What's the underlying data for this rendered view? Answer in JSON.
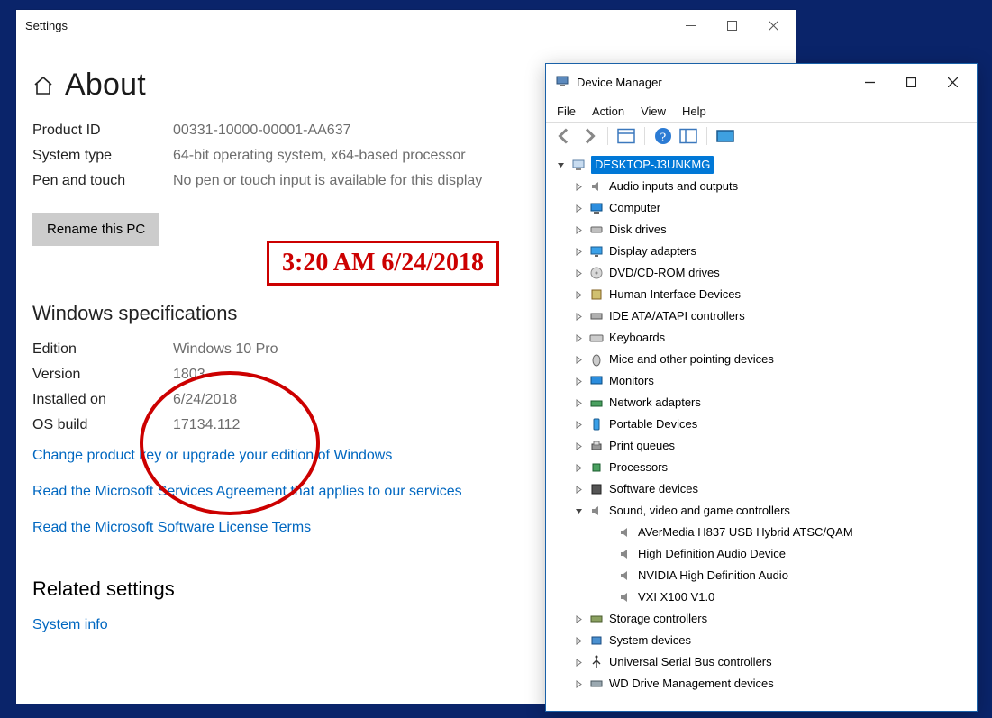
{
  "settings": {
    "window_title": "Settings",
    "page_title": "About",
    "device_specs": [
      {
        "label": "Product ID",
        "value": "00331-10000-00001-AA637"
      },
      {
        "label": "System type",
        "value": "64-bit operating system, x64-based processor"
      },
      {
        "label": "Pen and touch",
        "value": "No pen or touch input is available for this display"
      }
    ],
    "rename_button": "Rename this PC",
    "win_specs_heading": "Windows specifications",
    "win_specs": [
      {
        "label": "Edition",
        "value": "Windows 10 Pro"
      },
      {
        "label": "Version",
        "value": "1803"
      },
      {
        "label": "Installed on",
        "value": "6/24/2018"
      },
      {
        "label": "OS build",
        "value": "17134.112"
      }
    ],
    "links": [
      "Change product key or upgrade your edition of Windows",
      "Read the Microsoft Services Agreement that applies to our services",
      "Read the Microsoft Software License Terms"
    ],
    "related_heading": "Related settings",
    "related_link": "System info"
  },
  "annotation": {
    "timestamp": "3:20 AM 6/24/2018"
  },
  "device_manager": {
    "title": "Device Manager",
    "menus": [
      "File",
      "Action",
      "View",
      "Help"
    ],
    "root": "DESKTOP-J3UNKMG",
    "nodes": [
      {
        "label": "Audio inputs and outputs",
        "icon": "speaker-icon",
        "expanded": false
      },
      {
        "label": "Computer",
        "icon": "computer-icon",
        "expanded": false
      },
      {
        "label": "Disk drives",
        "icon": "disk-icon",
        "expanded": false
      },
      {
        "label": "Display adapters",
        "icon": "display-icon",
        "expanded": false
      },
      {
        "label": "DVD/CD-ROM drives",
        "icon": "disc-icon",
        "expanded": false
      },
      {
        "label": "Human Interface Devices",
        "icon": "hid-icon",
        "expanded": false
      },
      {
        "label": "IDE ATA/ATAPI controllers",
        "icon": "ide-icon",
        "expanded": false
      },
      {
        "label": "Keyboards",
        "icon": "keyboard-icon",
        "expanded": false
      },
      {
        "label": "Mice and other pointing devices",
        "icon": "mouse-icon",
        "expanded": false
      },
      {
        "label": "Monitors",
        "icon": "monitor-icon",
        "expanded": false
      },
      {
        "label": "Network adapters",
        "icon": "network-icon",
        "expanded": false
      },
      {
        "label": "Portable Devices",
        "icon": "portable-icon",
        "expanded": false
      },
      {
        "label": "Print queues",
        "icon": "printer-icon",
        "expanded": false
      },
      {
        "label": "Processors",
        "icon": "cpu-icon",
        "expanded": false
      },
      {
        "label": "Software devices",
        "icon": "software-icon",
        "expanded": false
      },
      {
        "label": "Sound, video and game controllers",
        "icon": "sound-icon",
        "expanded": true,
        "children": [
          {
            "label": "AVerMedia H837 USB Hybrid ATSC/QAM"
          },
          {
            "label": "High Definition Audio Device"
          },
          {
            "label": "NVIDIA High Definition Audio"
          },
          {
            "label": "VXI X100 V1.0"
          }
        ]
      },
      {
        "label": "Storage controllers",
        "icon": "storage-icon",
        "expanded": false
      },
      {
        "label": "System devices",
        "icon": "system-icon",
        "expanded": false
      },
      {
        "label": "Universal Serial Bus controllers",
        "icon": "usb-icon",
        "expanded": false
      },
      {
        "label": "WD Drive Management devices",
        "icon": "wd-icon",
        "expanded": false
      }
    ]
  }
}
